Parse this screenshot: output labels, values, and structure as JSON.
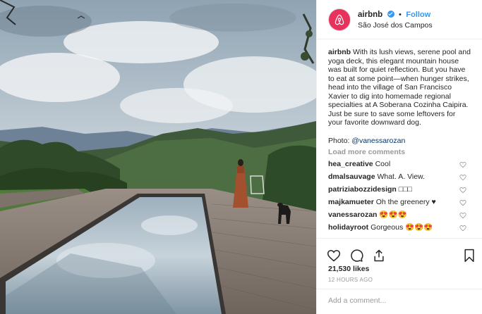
{
  "post": {
    "username": "airbnb",
    "follow_label": "Follow",
    "location": "São José dos Campos"
  },
  "caption": {
    "username": "airbnb",
    "text": "With its lush views, serene pool and yoga deck, this elegant mountain house was built for quiet reflection. But you have to eat at some point—when hunger strikes, head into the village of San Francisco Xavier to dig into homemade regional specialties at A Soberana Cozinha Caipira. Just be sure to save some leftovers for your favorite downward dog.",
    "photo_prefix": "Photo: ",
    "photo_handle": "@vanessarozan"
  },
  "load_more": "Load more comments",
  "comments": [
    {
      "user": "hea_creative",
      "text": "Cool"
    },
    {
      "user": "dmalsauvage",
      "text": "What. A. View."
    },
    {
      "user": "patriziabozzidesign",
      "text": "□□□"
    },
    {
      "user": "majkamueter",
      "text": "Oh the greenery ♥"
    },
    {
      "user": "vanessarozan",
      "text": "😍😍😍"
    },
    {
      "user": "holidayroot",
      "text": "Gorgeous 😍😍😍"
    }
  ],
  "likes": "21,530 likes",
  "time": "12 HOURS AGO",
  "add_comment_placeholder": "Add a comment...",
  "colors": {
    "brand": "#e8315b",
    "link": "#3897f0",
    "text": "#262626",
    "muted": "#999999"
  },
  "icons": [
    "airbnb-logo-icon",
    "verified-icon",
    "more-options-icon",
    "heart-icon",
    "comment-icon",
    "share-icon",
    "bookmark-icon"
  ]
}
